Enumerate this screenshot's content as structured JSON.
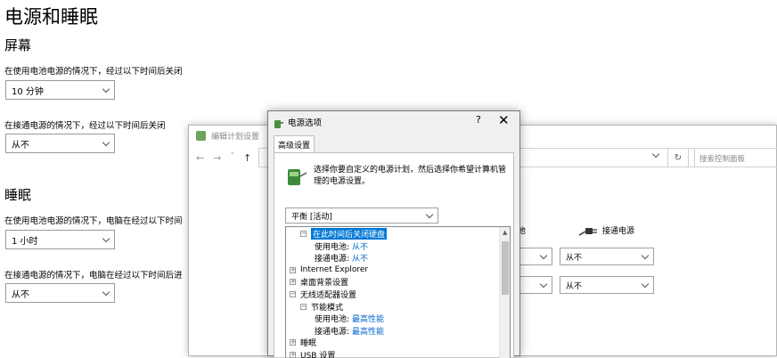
{
  "settings": {
    "title": "电源和睡眠",
    "screen": {
      "heading": "屏幕",
      "battery_label": "在使用电池电源的情况下，经过以下时间后关闭",
      "battery_value": "10 分钟",
      "plugged_label": "在接通电源的情况下，经过以下时间后关闭",
      "plugged_value": "从不"
    },
    "sleep": {
      "heading": "睡眠",
      "battery_label": "在使用电池电源的情况下，电脑在经过以下时间",
      "battery_value": "1 小时",
      "plugged_label": "在接通电源的情况下，电脑在经过以下时间后进",
      "plugged_value": "从不"
    }
  },
  "control_panel": {
    "title": "编辑计划设置",
    "nav": {
      "back": "←",
      "forward": "→",
      "recent": "˅",
      "up": "↑"
    },
    "search_placeholder": "搜索控制面板",
    "col_battery": "池",
    "col_plugged": "接通电源",
    "row1_battery": "",
    "row1_plugged": "从不",
    "row2_battery": "",
    "row2_plugged": "从不"
  },
  "dialog": {
    "title": "电源选项",
    "help": "?",
    "close": "✕",
    "tab": "高级设置",
    "intro": "选择你要自定义的电源计划，然后选择你希望计算机管理的电源设置。",
    "plan": "平衡 [活动]",
    "tree": [
      {
        "text": "在此时间后关闭硬盘",
        "sign": "⊟",
        "indent": 1,
        "selected": true
      },
      {
        "text": "使用电池:",
        "value": "从不",
        "indent": 2
      },
      {
        "text": "接通电源:",
        "value": "从不",
        "indent": 2
      },
      {
        "text": "Internet Explorer",
        "sign": "⊞",
        "indent": 0
      },
      {
        "text": "桌面背景设置",
        "sign": "⊞",
        "indent": 0
      },
      {
        "text": "无线适配器设置",
        "sign": "⊟",
        "indent": 0
      },
      {
        "text": "节能模式",
        "sign": "⊟",
        "indent": 1
      },
      {
        "text": "使用电池:",
        "value": "最高性能",
        "indent": 2
      },
      {
        "text": "接通电源:",
        "value": "最高性能",
        "indent": 2
      },
      {
        "text": "睡眠",
        "sign": "⊞",
        "indent": 0
      },
      {
        "text": "USB 设置",
        "sign": "⊞",
        "indent": 0
      }
    ]
  },
  "colors": {
    "accent": "#0078d7",
    "link_value": "#0066cc"
  }
}
